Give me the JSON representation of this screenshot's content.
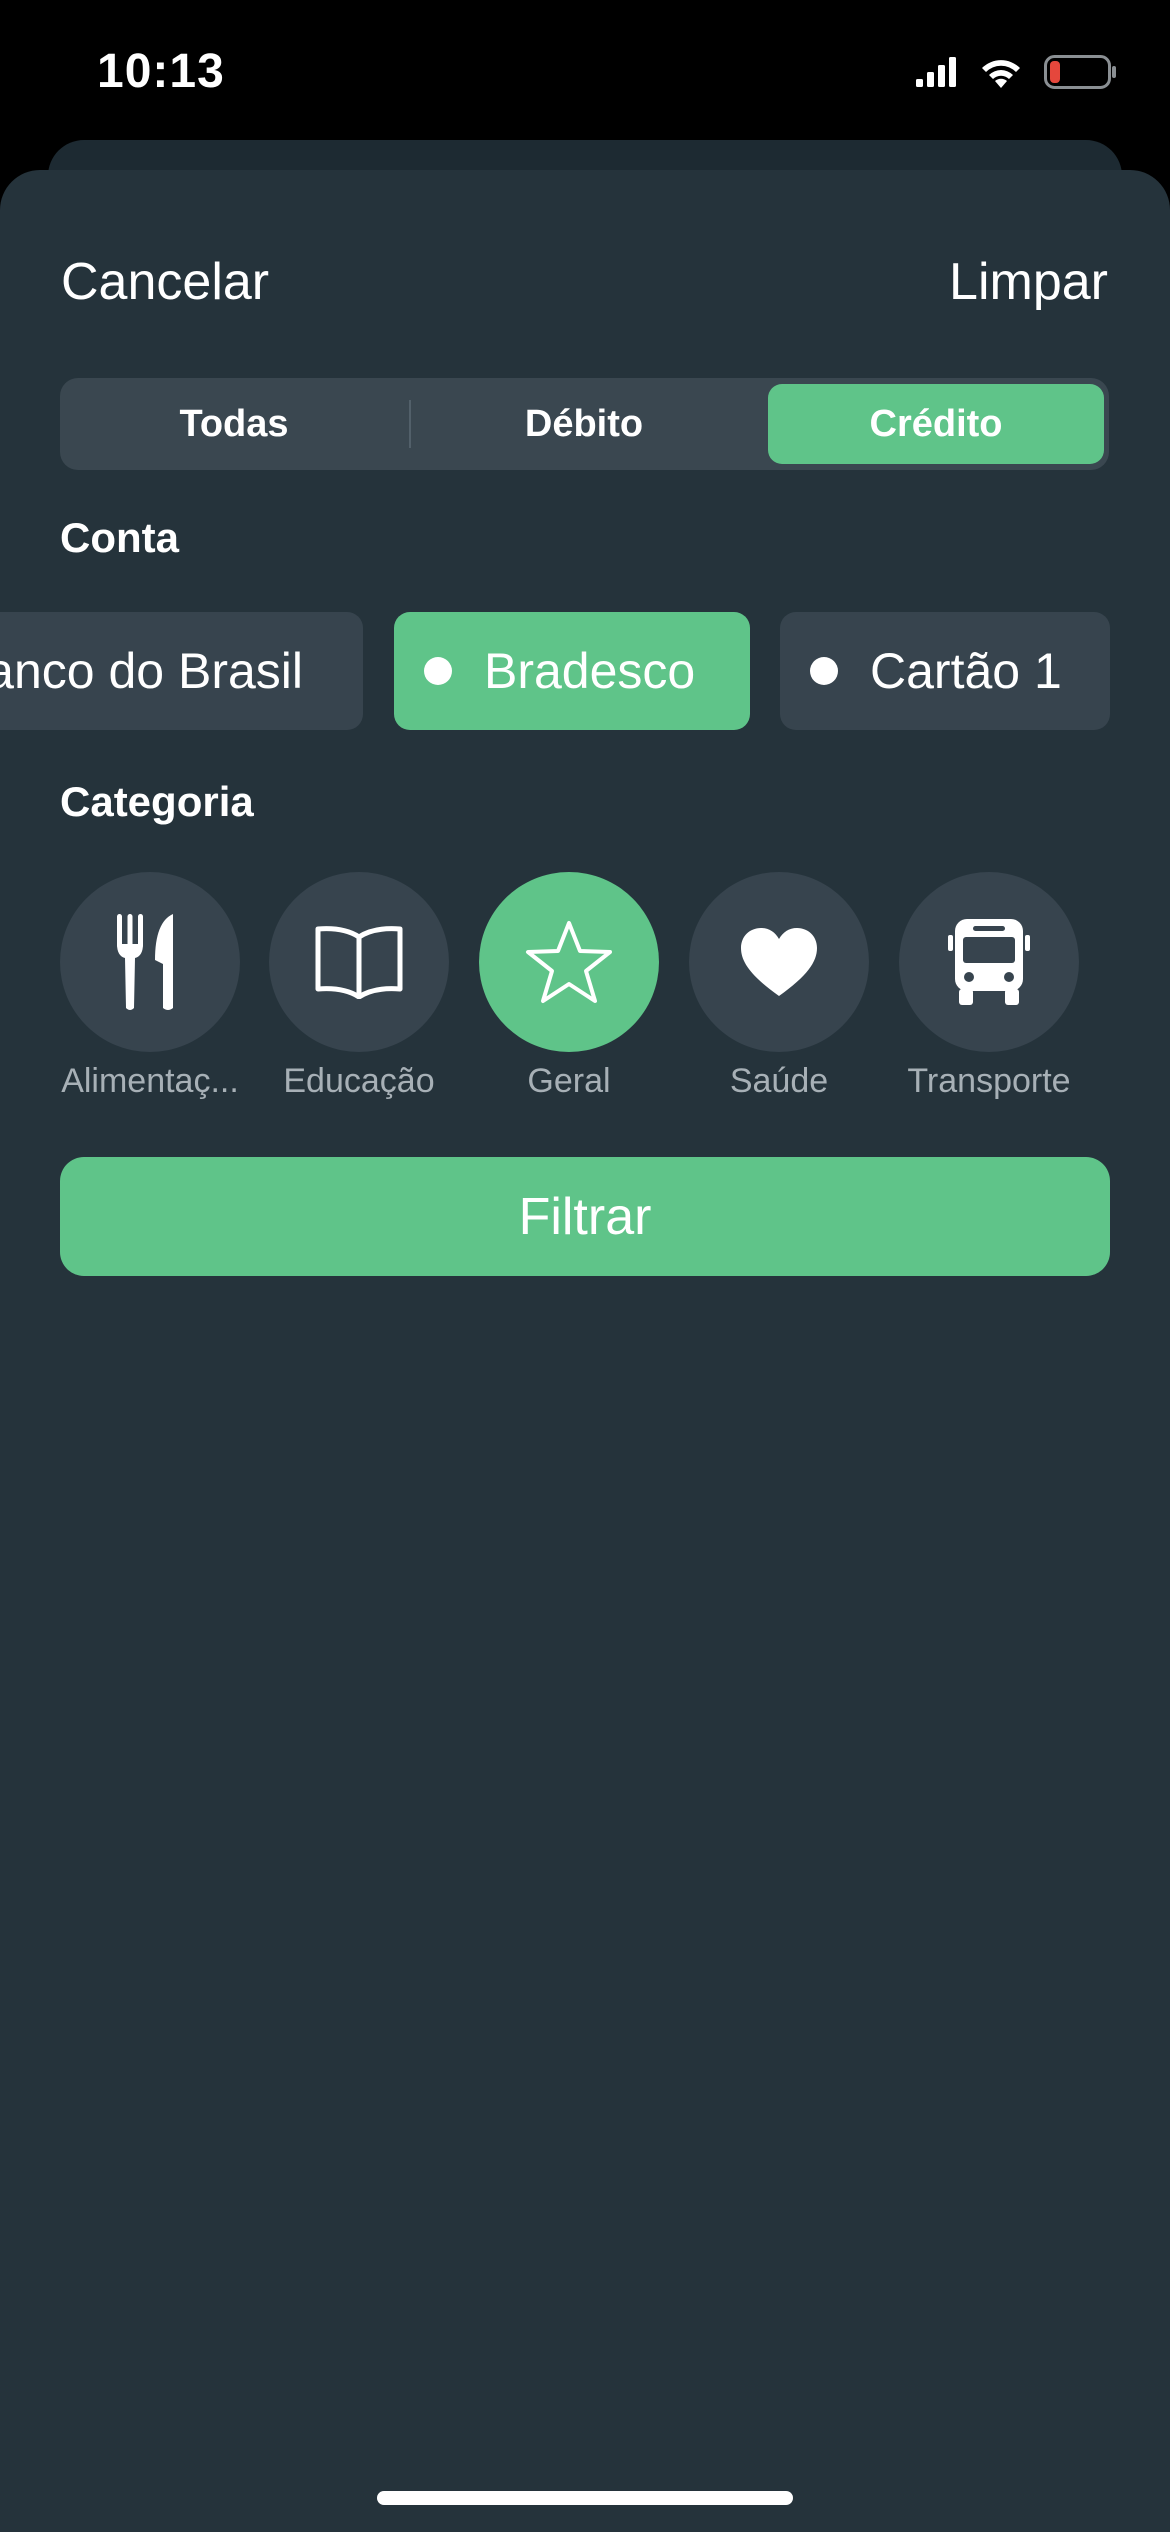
{
  "status_bar": {
    "time": "10:13",
    "battery_color": "#e5473c"
  },
  "header": {
    "cancel_label": "Cancelar",
    "clear_label": "Limpar"
  },
  "type_filter": {
    "segments": [
      "Todas",
      "Débito",
      "Crédito"
    ],
    "selected": "Crédito"
  },
  "accounts": {
    "section_label": "Conta",
    "items": [
      "Banco do Brasil",
      "Bradesco",
      "Cartão 1"
    ],
    "selected": "Bradesco"
  },
  "categories": {
    "section_label": "Categoria",
    "items": [
      {
        "label": "Alimentaç...",
        "icon": "fork-knife-icon"
      },
      {
        "label": "Educação",
        "icon": "book-icon"
      },
      {
        "label": "Geral",
        "icon": "star-icon"
      },
      {
        "label": "Saúde",
        "icon": "heart-icon"
      },
      {
        "label": "Transporte",
        "icon": "bus-icon"
      }
    ],
    "selected": "Geral"
  },
  "filter_button_label": "Filtrar",
  "colors": {
    "accent": "#5fc489",
    "sheet_background": "#25333b",
    "chip_background": "#37444e"
  }
}
